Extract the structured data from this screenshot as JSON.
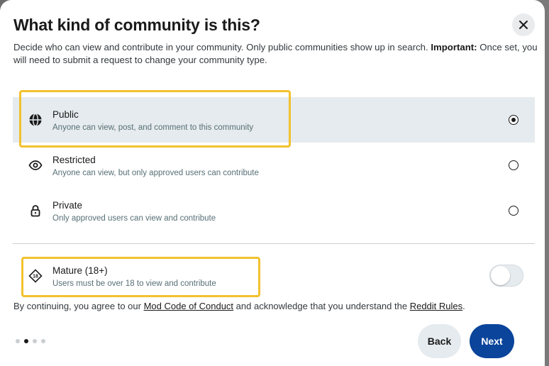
{
  "dialog": {
    "title": "What kind of community is this?",
    "description": "Decide who can view and contribute in your community. Only public communities show up in search.",
    "description_important_label": "Important:",
    "description_important_text": "Once set, you will need to submit a request to change your community type."
  },
  "options": [
    {
      "label": "Public",
      "sub": "Anyone can view, post, and comment to this community",
      "icon": "globe-icon",
      "selected": true
    },
    {
      "label": "Restricted",
      "sub": "Anyone can view, but only approved users can contribute",
      "icon": "eye-icon",
      "selected": false
    },
    {
      "label": "Private",
      "sub": "Only approved users can view and contribute",
      "icon": "lock-icon",
      "selected": false
    }
  ],
  "mature": {
    "label": "Mature (18+)",
    "sub": "Users must be over 18 to view and contribute",
    "icon": "age-18-icon",
    "badge_text": "18",
    "enabled": false
  },
  "terms": {
    "prefix": "By continuing, you agree to our",
    "link1": "Mod Code of Conduct",
    "middle": "and acknowledge that you understand the",
    "link2": "Reddit Rules",
    "suffix": "."
  },
  "pagination": {
    "total": 4,
    "current": 2
  },
  "buttons": {
    "back": "Back",
    "next": "Next"
  },
  "colors": {
    "primary": "#0a449b",
    "selected_bg": "#e5ebee",
    "highlight": "#f2c12e"
  }
}
